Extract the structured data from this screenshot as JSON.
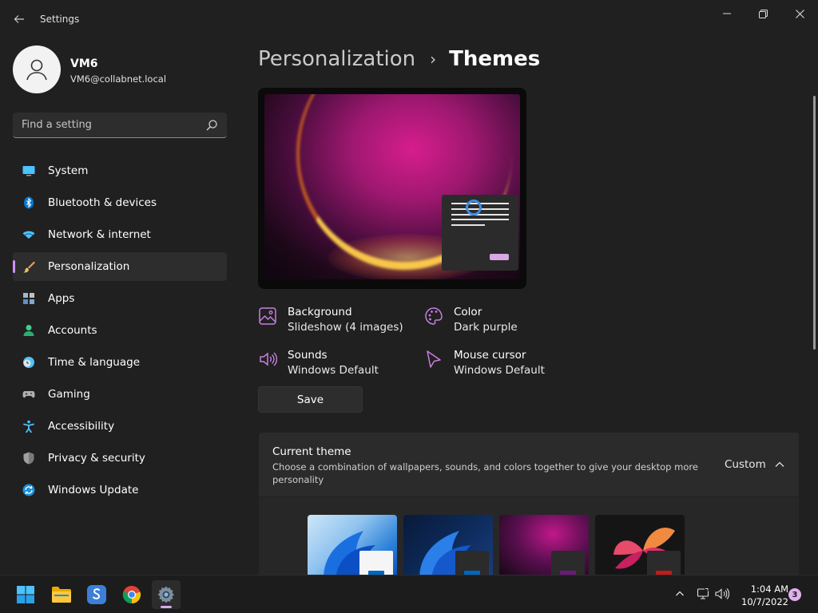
{
  "app": {
    "title": "Settings"
  },
  "window_controls": {
    "minimize": "—",
    "maximize": "❐",
    "close": "✕"
  },
  "profile": {
    "name": "VM6",
    "email": "VM6@collabnet.local"
  },
  "search": {
    "placeholder": "Find a setting"
  },
  "nav": {
    "items": [
      {
        "label": "System",
        "icon": "system-icon",
        "color": "#4cc2ff"
      },
      {
        "label": "Bluetooth & devices",
        "icon": "bluetooth-icon",
        "color": "#0078d4"
      },
      {
        "label": "Network & internet",
        "icon": "wifi-icon",
        "color": "#4cc2ff"
      },
      {
        "label": "Personalization",
        "icon": "paintbrush-icon",
        "color": "#e0a060",
        "active": true
      },
      {
        "label": "Apps",
        "icon": "apps-icon",
        "color": "#9ab8d8"
      },
      {
        "label": "Accounts",
        "icon": "accounts-icon",
        "color": "#3ecf8e"
      },
      {
        "label": "Time & language",
        "icon": "clock-globe-icon",
        "color": "#4cc2ff"
      },
      {
        "label": "Gaming",
        "icon": "gamepad-icon",
        "color": "#b0b0b0"
      },
      {
        "label": "Accessibility",
        "icon": "accessibility-icon",
        "color": "#4cc2ff"
      },
      {
        "label": "Privacy & security",
        "icon": "shield-icon",
        "color": "#a0a0a0"
      },
      {
        "label": "Windows Update",
        "icon": "update-icon",
        "color": "#4cc2ff"
      }
    ]
  },
  "breadcrumb": {
    "parent": "Personalization",
    "separator": "›",
    "current": "Themes"
  },
  "properties": {
    "background": {
      "title": "Background",
      "value": "Slideshow (4 images)",
      "icon": "image-icon"
    },
    "color": {
      "title": "Color",
      "value": "Dark purple",
      "icon": "palette-icon"
    },
    "sounds": {
      "title": "Sounds",
      "value": "Windows Default",
      "icon": "speaker-icon"
    },
    "cursor": {
      "title": "Mouse cursor",
      "value": "Windows Default",
      "icon": "cursor-icon"
    }
  },
  "save_label": "Save",
  "current_theme": {
    "title": "Current theme",
    "description": "Choose a combination of wallpapers, sounds, and colors together to give your desktop more personality",
    "value": "Custom"
  },
  "themes": [
    {
      "name": "windows-light-theme",
      "accent": "#0067c0"
    },
    {
      "name": "windows-dark-theme",
      "accent": "#0067c0"
    },
    {
      "name": "glow-theme",
      "accent": "#6b1a7a"
    },
    {
      "name": "captured-motion-theme",
      "accent": "#c41a1a"
    }
  ],
  "accent_color": "#d090ff",
  "taskbar": {
    "apps": [
      "start-icon",
      "file-explorer-icon",
      "app-s-icon",
      "chrome-icon",
      "settings-icon"
    ],
    "time": "1:04 AM",
    "date": "10/7/2022",
    "notifications": "3"
  }
}
